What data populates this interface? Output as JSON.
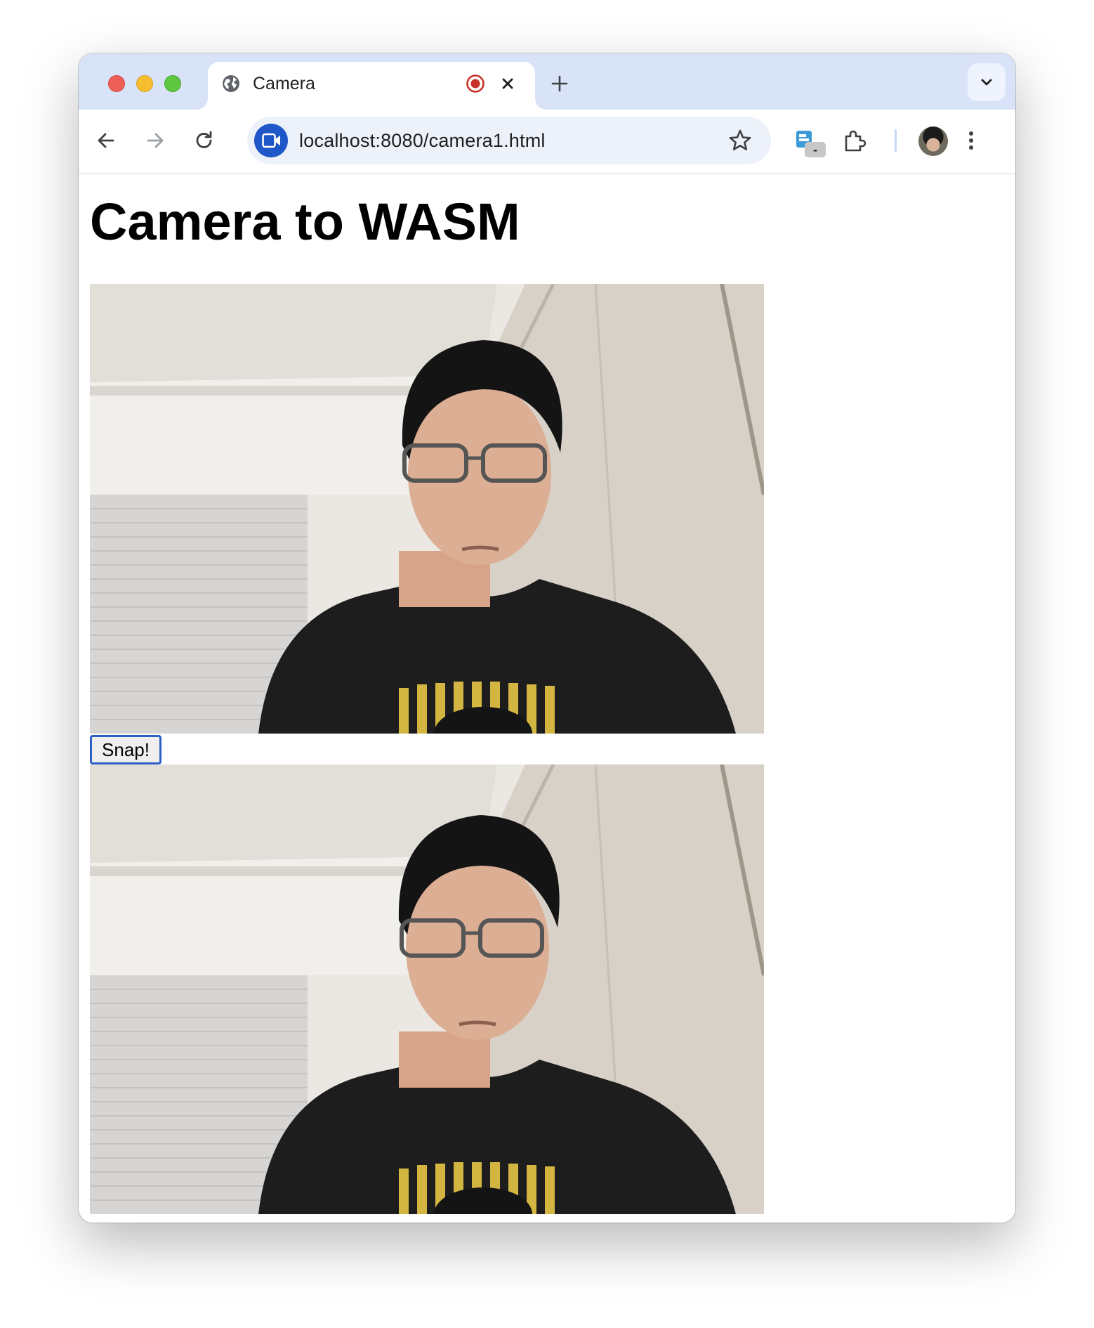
{
  "browser": {
    "tab": {
      "title": "Camera",
      "favicon": "globe-icon",
      "recording_indicator": "record-icon",
      "close": "close-icon"
    },
    "new_tab": "plus-icon",
    "tab_search": "chevron-down-icon",
    "toolbar": {
      "back": "back-arrow-icon",
      "forward": "forward-arrow-icon",
      "reload": "reload-icon",
      "site_info": "video-camera-icon",
      "url": "localhost:8080/camera1.html",
      "bookmark": "star-icon",
      "extension_badge_text": "-",
      "extensions": "puzzle-icon",
      "menu": "kebab-menu-icon"
    },
    "colors": {
      "tabstrip": "#d8e3f8",
      "omnibox": "#edf1fa",
      "site_badge": "#1f57c8",
      "record": "#c8312a",
      "snap_button_border": "#2d5fc5"
    }
  },
  "page": {
    "heading": "Camera to WASM",
    "snap_button": "Snap!"
  }
}
